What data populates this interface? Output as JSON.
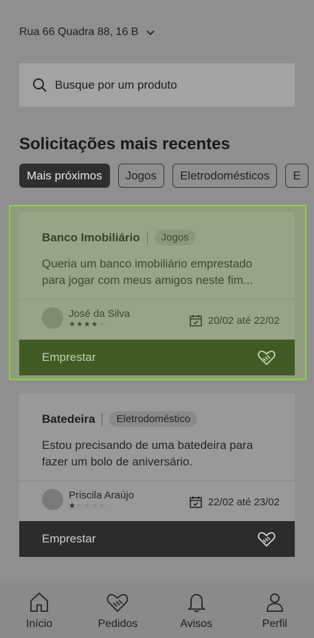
{
  "address": {
    "text": "Rua 66 Quadra 88, 16 B"
  },
  "search": {
    "placeholder": "Busque por um produto"
  },
  "section_title": "Solicitações mais recentes",
  "filters": [
    {
      "label": "Mais próximos"
    },
    {
      "label": "Jogos"
    },
    {
      "label": "Eletrodomésticos"
    },
    {
      "label": "E"
    }
  ],
  "requests": [
    {
      "product": "Banco Imobiliário",
      "category": "Jogos",
      "description": "Queria um banco imobiliário emprestado para jogar com meus amigos neste fim...",
      "user": "José da Silva",
      "rating": 4,
      "dates": "20/02 até 22/02",
      "action": "Emprestar"
    },
    {
      "product": "Batedeira",
      "category": "Eletrodoméstico",
      "description": "Estou precisando de uma batedeira para fazer um bolo de aniversário.",
      "user": "Priscila Araújo",
      "rating": 1,
      "dates": "22/02 até 23/02",
      "action": "Emprestar"
    }
  ],
  "nav": [
    {
      "label": "Início",
      "icon": "home-icon"
    },
    {
      "label": "Pedidos",
      "icon": "handshake-heart-icon"
    },
    {
      "label": "Avisos",
      "icon": "bell-icon"
    },
    {
      "label": "Perfil",
      "icon": "user-icon"
    }
  ],
  "colors": {
    "highlight": "#8bd13f",
    "bar": "#2c2c2c",
    "background": "#8f8f8f"
  }
}
